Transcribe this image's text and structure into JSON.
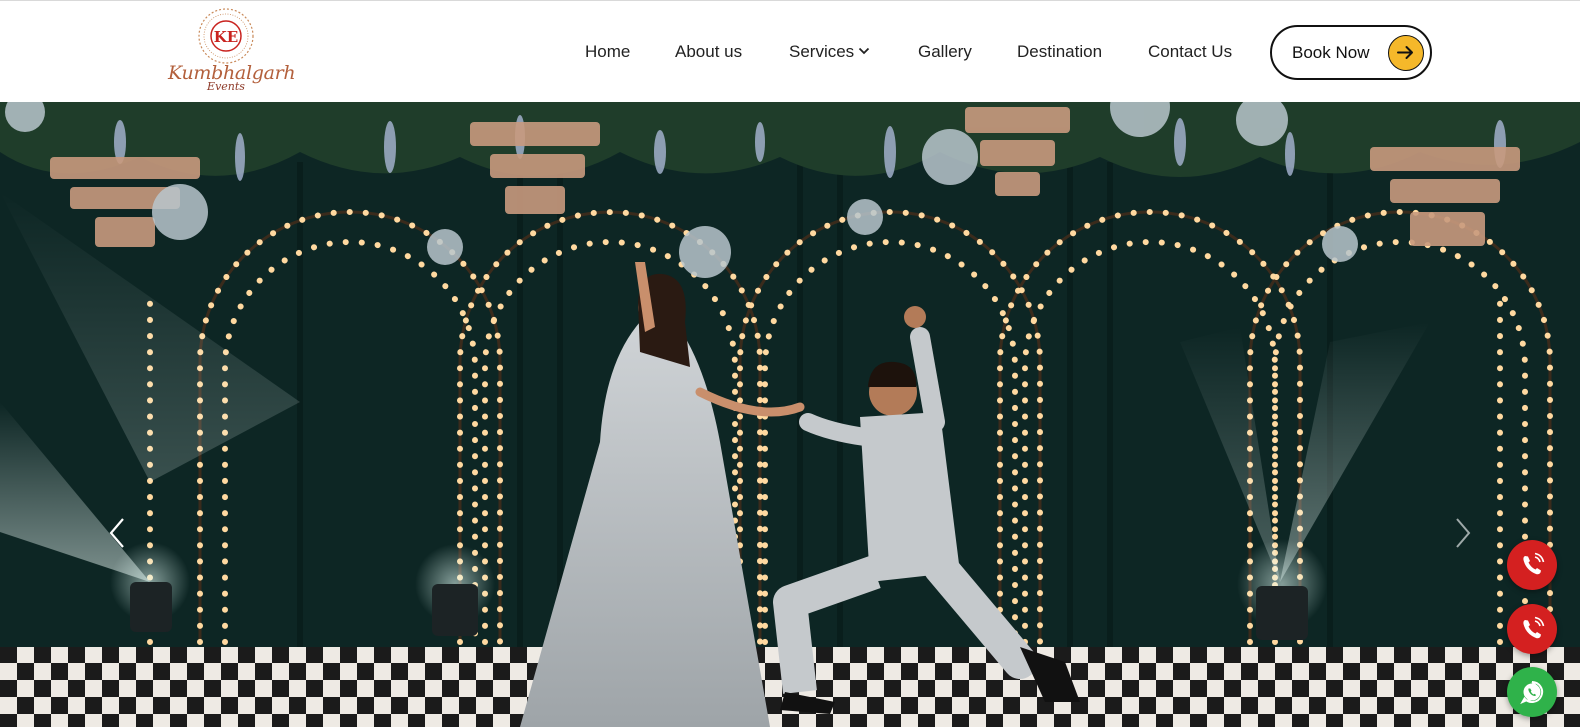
{
  "brand": {
    "name": "Kumbhalgarh",
    "subname": "Events",
    "monogram": "KE",
    "colors": {
      "primary": "#b3603c",
      "accent": "#c9231f"
    }
  },
  "nav": {
    "items": [
      {
        "label": "Home"
      },
      {
        "label": "About us"
      },
      {
        "label": "Services",
        "has_dropdown": true
      },
      {
        "label": "Gallery"
      },
      {
        "label": "Destination"
      },
      {
        "label": "Contact Us"
      }
    ],
    "cta": {
      "label": "Book Now",
      "icon": "arrow-right-icon",
      "color": "#f5b82a"
    }
  },
  "hero": {
    "image": "wedding-couple-stage-photo",
    "prev_icon": "chevron-left-icon",
    "next_icon": "chevron-right-icon"
  },
  "floating_actions": [
    {
      "icon": "phone-icon",
      "color": "#d42020"
    },
    {
      "icon": "phone-icon",
      "color": "#d42020"
    },
    {
      "icon": "whatsapp-icon",
      "color": "#2fb24a"
    }
  ]
}
